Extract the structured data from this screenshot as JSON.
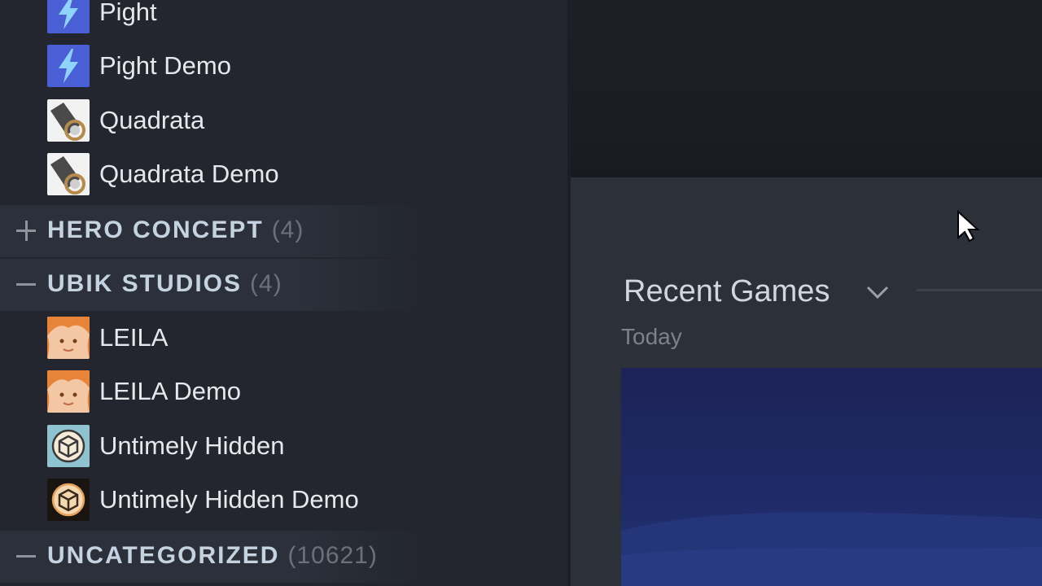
{
  "sidebar": {
    "games_top": [
      {
        "label": "Pight",
        "icon": "lightning-icon"
      },
      {
        "label": "Pight Demo",
        "icon": "lightning-icon"
      },
      {
        "label": "Quadrata",
        "icon": "quadrata-icon"
      },
      {
        "label": "Quadrata Demo",
        "icon": "quadrata-icon"
      }
    ],
    "categories": [
      {
        "name": "HERO CONCEPT",
        "count": "(4)",
        "state": "collapsed",
        "toggle_icon": "plus-icon"
      },
      {
        "name": "UBIK STUDIOS",
        "count": "(4)",
        "state": "expanded",
        "toggle_icon": "minus-icon"
      },
      {
        "name": "UNCATEGORIZED",
        "count": "(10621)",
        "state": "expanded",
        "toggle_icon": "minus-icon"
      }
    ],
    "games_ubik": [
      {
        "label": "LEILA",
        "icon": "leila-portrait-icon"
      },
      {
        "label": "LEILA Demo",
        "icon": "leila-portrait-icon"
      },
      {
        "label": "Untimely Hidden",
        "icon": "cube-icon"
      },
      {
        "label": "Untimely Hidden Demo",
        "icon": "cube-icon"
      }
    ]
  },
  "main": {
    "shelf_title": "Recent Games",
    "shelf_subtitle": "Today"
  },
  "colors": {
    "sidebar_bg": "#23262e",
    "category_bg": "#2b303a",
    "category_text": "#c5d3e0",
    "main_panel_bg": "#2c3038",
    "card_bg": "#1e2a66"
  }
}
